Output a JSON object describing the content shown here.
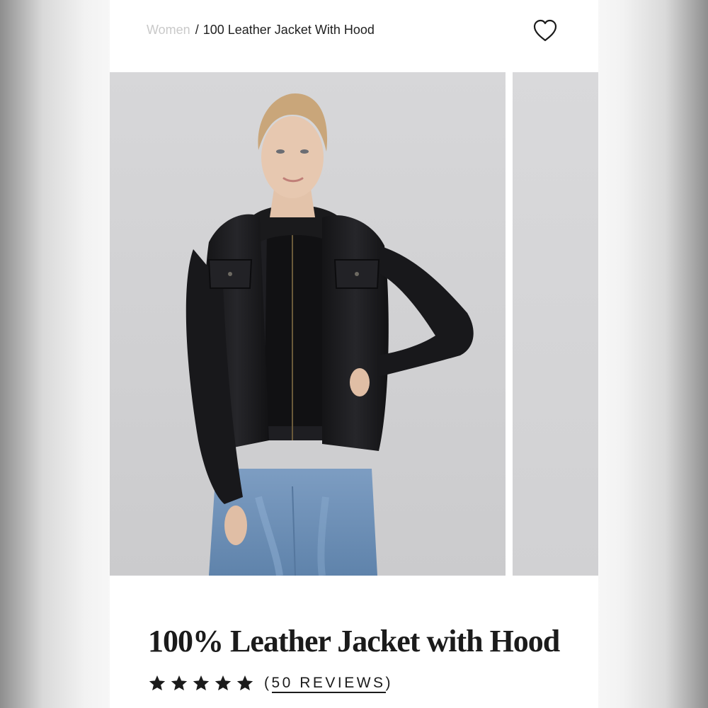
{
  "breadcrumb": {
    "parent": "Women",
    "separator": "/",
    "current": "100 Leather Jacket With Hood"
  },
  "wishlist": {
    "icon": "heart-outline-icon"
  },
  "gallery": {
    "main_image": "model-wearing-black-leather-jacket-with-hood",
    "next_image": "next-product-photo-preview"
  },
  "product": {
    "title": "100% Leather Jacket with Hood",
    "rating": {
      "stars": 5,
      "max": 5
    },
    "reviews": {
      "open": "(",
      "label": "50 REVIEWS",
      "close": ")"
    }
  },
  "colors": {
    "text": "#1b1b1b",
    "breadcrumb_muted": "#c9c9c9",
    "photo_background": "#d4d4d6",
    "jacket": "#1a1a1c",
    "denim": "#6f92b8"
  }
}
